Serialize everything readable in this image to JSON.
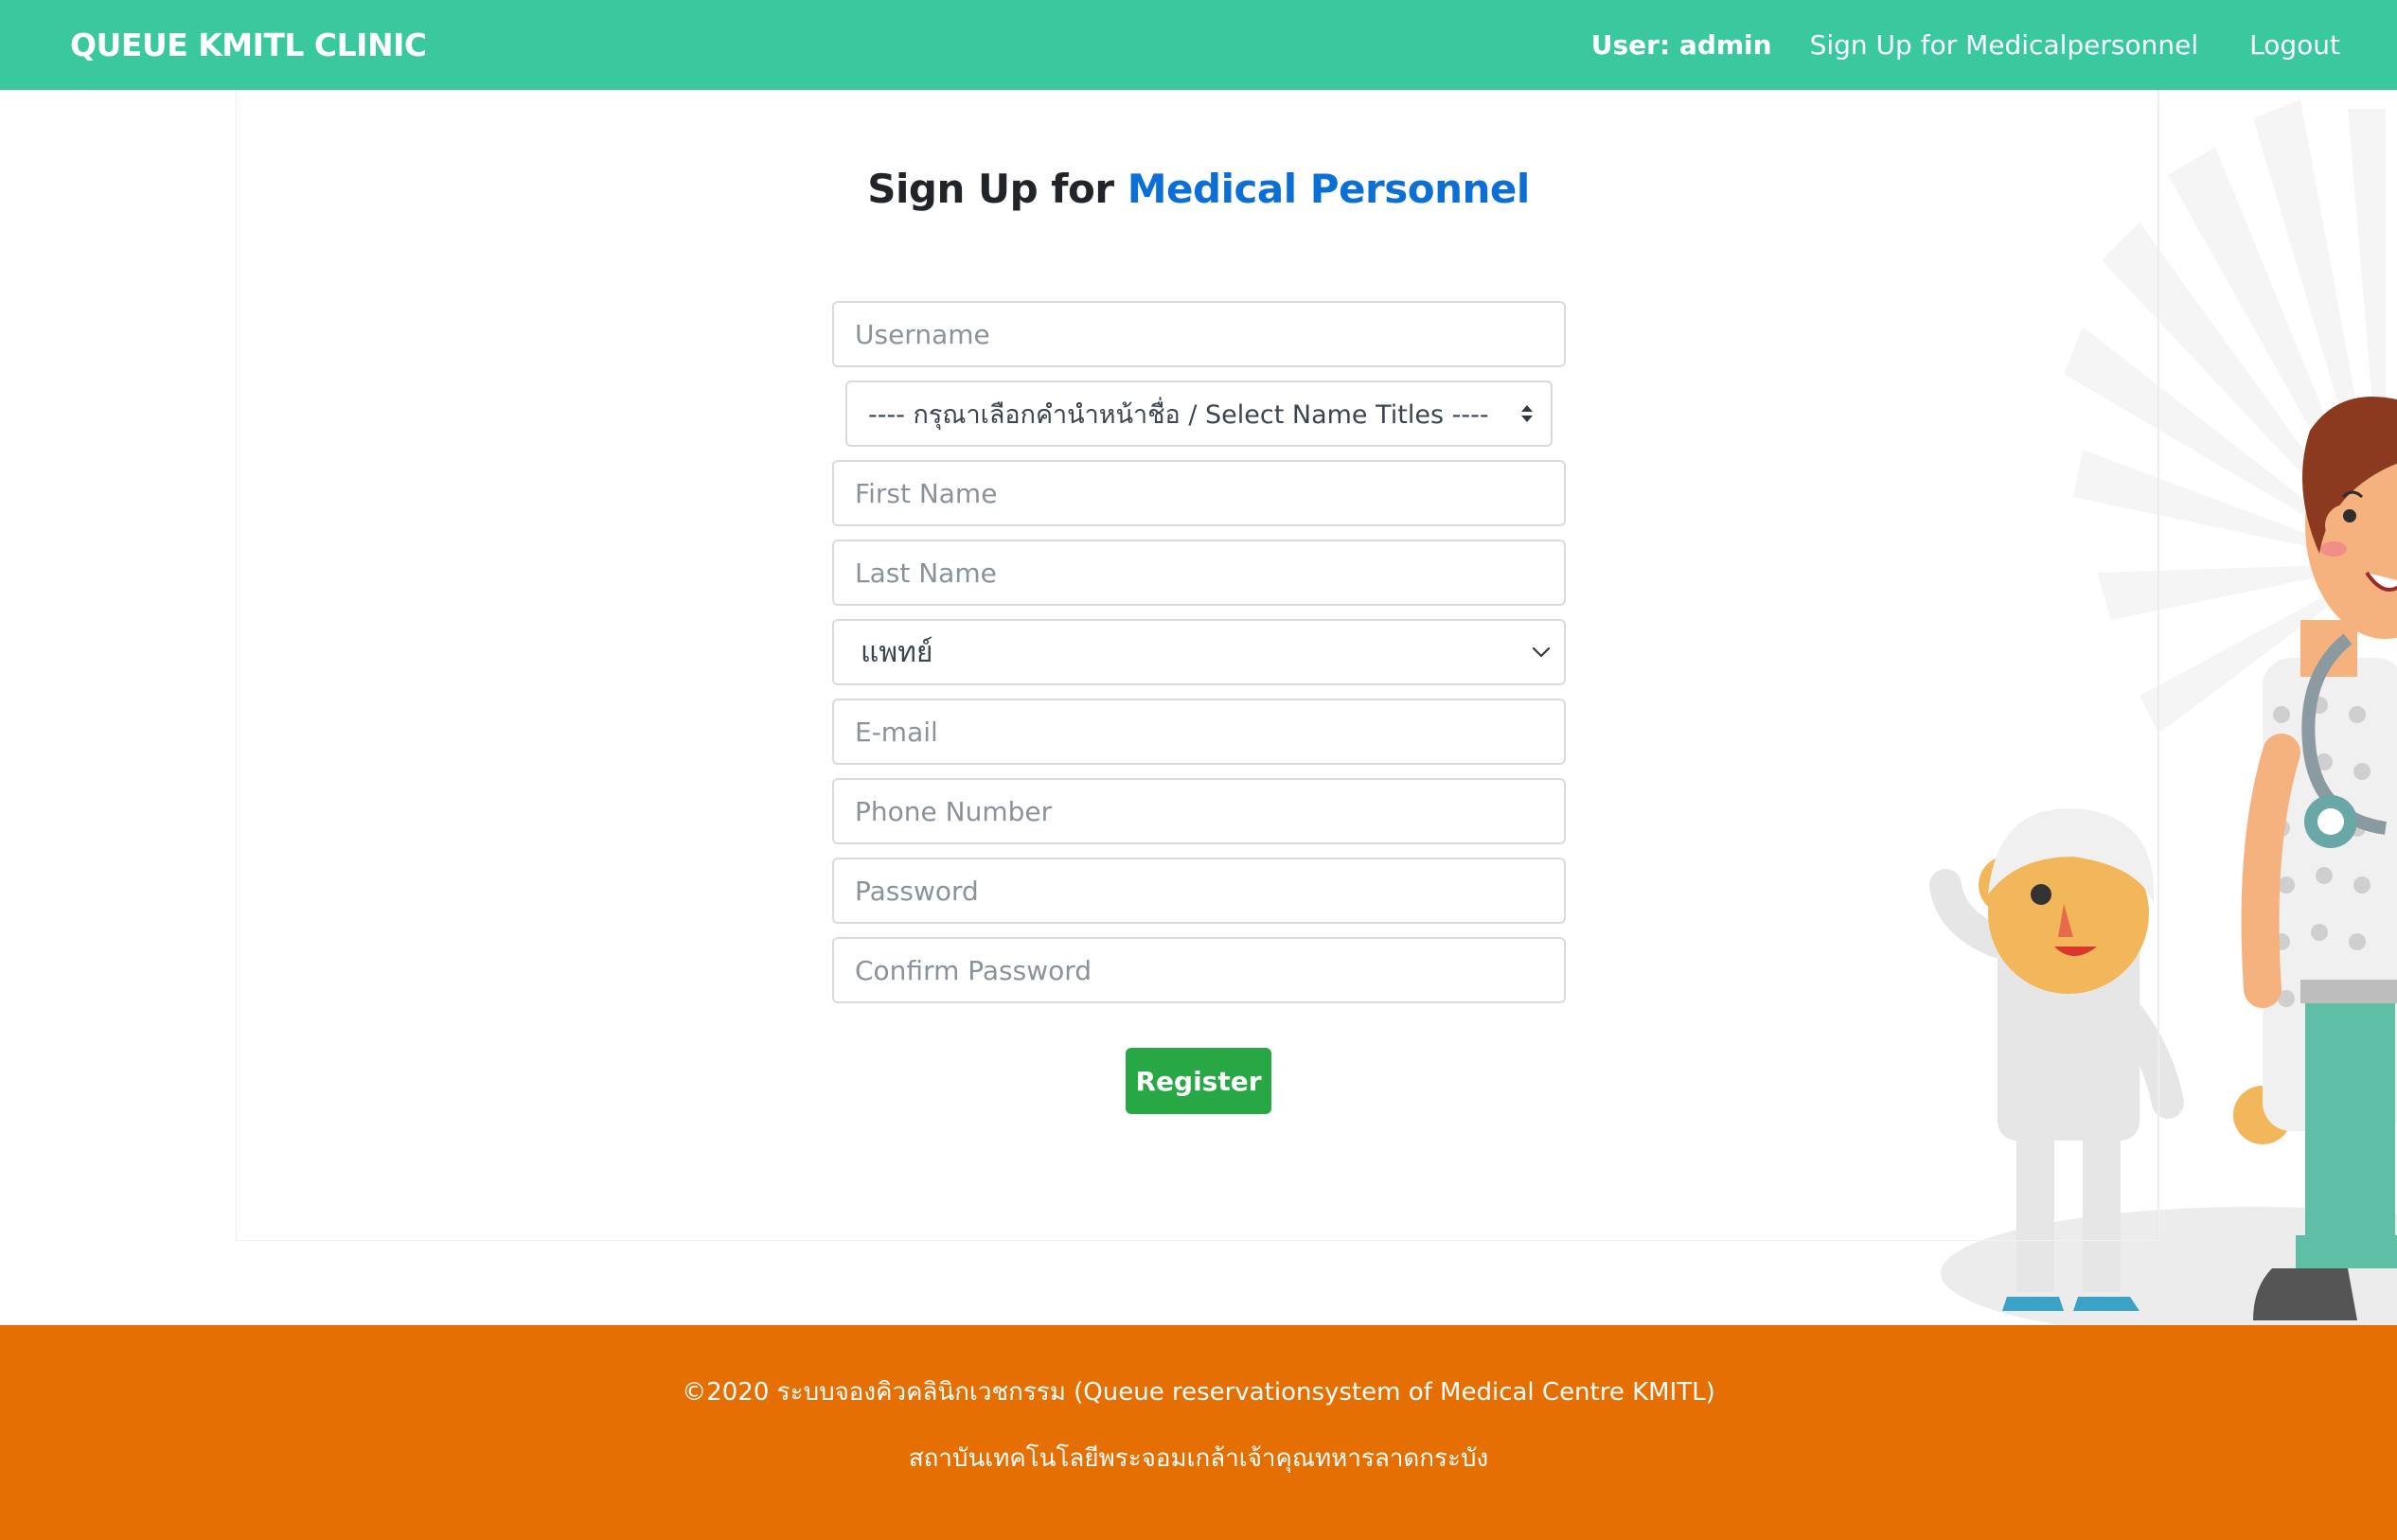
{
  "navbar": {
    "brand": "QUEUE KMITL CLINIC",
    "user_label": "User: admin",
    "signup_link": "Sign Up for Medicalpersonnel",
    "logout_link": "Logout",
    "background_color": "#3ac99e"
  },
  "page": {
    "title_prefix": "Sign Up for",
    "title_accent": "Medical Personnel",
    "accent_color": "#0b6fd6"
  },
  "form": {
    "username_placeholder": "Username",
    "name_title_selected": "---- กรุณาเลือกคำนำหน้าชื่อ / Select Name Titles ----",
    "first_name_placeholder": "First Name",
    "last_name_placeholder": "Last Name",
    "role_selected": "แพทย์",
    "email_placeholder": "E-mail",
    "phone_placeholder": "Phone Number",
    "password_placeholder": "Password",
    "confirm_password_placeholder": "Confirm Password",
    "register_label": "Register",
    "register_color": "#28a745"
  },
  "footer": {
    "line1": "©2020 ระบบจองคิวคลินิกเวชกรรม (Queue reservationsystem of Medical Centre KMITL)",
    "line2": "สถาบันเทคโนโลยีพระจอมเกล้าเจ้าคุณทหารลาดกระบัง",
    "background_color": "#e56f02"
  }
}
